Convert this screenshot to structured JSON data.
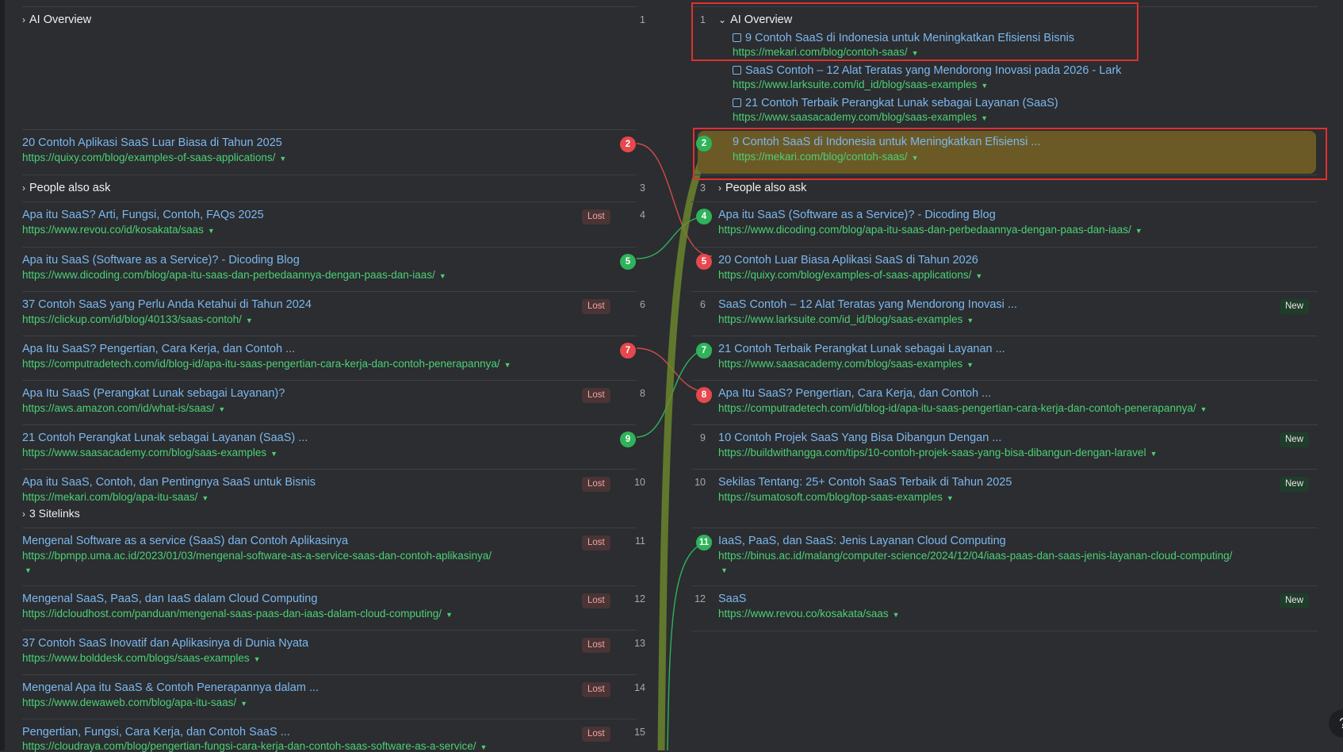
{
  "left": {
    "ai_overview": {
      "label": "AI Overview",
      "pos": "1"
    },
    "rows": [
      {
        "pos": "2",
        "title": "20 Contoh Aplikasi SaaS Luar Biasa di Tahun 2025",
        "url": "https://quixy.com/blog/examples-of-saas-applications/",
        "status": "moved-red"
      },
      {
        "pos": "3",
        "section": "People also ask"
      },
      {
        "pos": "4",
        "title": "Apa itu SaaS? Arti, Fungsi, Contoh, FAQs 2025",
        "url": "https://www.revou.co/id/kosakata/saas",
        "status": "lost"
      },
      {
        "pos": "5",
        "title": "Apa itu SaaS (Software as a Service)? - Dicoding Blog",
        "url": "https://www.dicoding.com/blog/apa-itu-saas-dan-perbedaannya-dengan-paas-dan-iaas/",
        "status": "moved-green"
      },
      {
        "pos": "6",
        "title": "37 Contoh SaaS yang Perlu Anda Ketahui di Tahun 2024",
        "url": "https://clickup.com/id/blog/40133/saas-contoh/",
        "status": "lost"
      },
      {
        "pos": "7",
        "title": "Apa Itu SaaS? Pengertian, Cara Kerja, dan Contoh ...",
        "url": "https://computradetech.com/id/blog-id/apa-itu-saas-pengertian-cara-kerja-dan-contoh-penerapannya/",
        "status": "moved-red"
      },
      {
        "pos": "8",
        "title": "Apa Itu SaaS (Perangkat Lunak sebagai Layanan)?",
        "url": "https://aws.amazon.com/id/what-is/saas/",
        "status": "lost"
      },
      {
        "pos": "9",
        "title": "21 Contoh Perangkat Lunak sebagai Layanan (SaaS) ...",
        "url": "https://www.saasacademy.com/blog/saas-examples",
        "status": "moved-green"
      },
      {
        "pos": "10",
        "title": "Apa itu SaaS, Contoh, dan Pentingnya SaaS untuk Bisnis",
        "url": "https://mekari.com/blog/apa-itu-saas/",
        "status": "lost",
        "sitelinks": "3 Sitelinks"
      },
      {
        "pos": "11",
        "title": "Mengenal Software as a service (SaaS) dan Contoh Aplikasinya",
        "url": "https://bpmpp.uma.ac.id/2023/01/03/mengenal-software-as-a-service-saas-dan-contoh-aplikasinya/",
        "status": "lost",
        "wrap": true
      },
      {
        "pos": "12",
        "title": "Mengenal SaaS, PaaS, dan IaaS dalam Cloud Computing",
        "url": "https://idcloudhost.com/panduan/mengenal-saas-paas-dan-iaas-dalam-cloud-computing/",
        "status": "lost"
      },
      {
        "pos": "13",
        "title": "37 Contoh SaaS Inovatif dan Aplikasinya di Dunia Nyata",
        "url": "https://www.bolddesk.com/blogs/saas-examples",
        "status": "lost"
      },
      {
        "pos": "14",
        "title": "Mengenal Apa itu SaaS & Contoh Penerapannya dalam ...",
        "url": "https://www.dewaweb.com/blog/apa-itu-saas/",
        "status": "lost"
      },
      {
        "pos": "15",
        "title": "Pengertian, Fungsi, Cara Kerja, dan Contoh SaaS ...",
        "url": "https://cloudraya.com/blog/pengertian-fungsi-cara-kerja-dan-contoh-saas-software-as-a-service/",
        "status": "lost"
      }
    ]
  },
  "right": {
    "ai_overview": {
      "pos": "1",
      "label": "AI Overview",
      "items": [
        {
          "title": "9 Contoh SaaS di Indonesia untuk Meningkatkan Efisiensi Bisnis",
          "url": "https://mekari.com/blog/contoh-saas/"
        },
        {
          "title": "SaaS Contoh – 12 Alat Teratas yang Mendorong Inovasi pada 2026 - Lark",
          "url": "https://www.larksuite.com/id_id/blog/saas-examples"
        },
        {
          "title": "21 Contoh Terbaik Perangkat Lunak sebagai Layanan (SaaS)",
          "url": "https://www.saasacademy.com/blog/saas-examples"
        }
      ]
    },
    "rows": [
      {
        "pos": "2",
        "title": "9 Contoh SaaS di Indonesia untuk Meningkatkan Efisiensi ...",
        "url": "https://mekari.com/blog/contoh-saas/",
        "status": "moved-green",
        "highlight": true
      },
      {
        "pos": "3",
        "section": "People also ask"
      },
      {
        "pos": "4",
        "title": "Apa itu SaaS (Software as a Service)? - Dicoding Blog",
        "url": "https://www.dicoding.com/blog/apa-itu-saas-dan-perbedaannya-dengan-paas-dan-iaas/",
        "status": "moved-green"
      },
      {
        "pos": "5",
        "title": "20 Contoh Luar Biasa Aplikasi SaaS di Tahun 2026",
        "url": "https://quixy.com/blog/examples-of-saas-applications/",
        "status": "moved-red"
      },
      {
        "pos": "6",
        "title": "SaaS Contoh – 12 Alat Teratas yang Mendorong Inovasi ...",
        "url": "https://www.larksuite.com/id_id/blog/saas-examples",
        "status": "new"
      },
      {
        "pos": "7",
        "title": "21 Contoh Terbaik Perangkat Lunak sebagai Layanan ...",
        "url": "https://www.saasacademy.com/blog/saas-examples",
        "status": "moved-green"
      },
      {
        "pos": "8",
        "title": "Apa Itu SaaS? Pengertian, Cara Kerja, dan Contoh ...",
        "url": "https://computradetech.com/id/blog-id/apa-itu-saas-pengertian-cara-kerja-dan-contoh-penerapannya/",
        "status": "moved-red"
      },
      {
        "pos": "9",
        "title": "10 Contoh Projek SaaS Yang Bisa Dibangun Dengan ...",
        "url": "https://buildwithangga.com/tips/10-contoh-projek-saas-yang-bisa-dibangun-dengan-laravel",
        "status": "new"
      },
      {
        "pos": "10",
        "title": "Sekilas Tentang: 25+ Contoh SaaS Terbaik di Tahun 2025",
        "url": "https://sumatosoft.com/blog/top-saas-examples",
        "status": "new"
      },
      {
        "pos": "11",
        "title": "IaaS, PaaS, dan SaaS: Jenis Layanan Cloud Computing",
        "url": "https://binus.ac.id/malang/computer-science/2024/12/04/iaas-paas-dan-saas-jenis-layanan-cloud-computing/",
        "status": "moved-green",
        "wrap": true
      },
      {
        "pos": "12",
        "title": "SaaS",
        "url": "https://www.revou.co/kosakata/saas",
        "status": "new"
      }
    ]
  },
  "labels": {
    "lost": "Lost",
    "new": "New",
    "help": "?"
  },
  "colors": {
    "red": "#e5484d",
    "green": "#2eb35a",
    "highlight_box": "#e0302f"
  }
}
